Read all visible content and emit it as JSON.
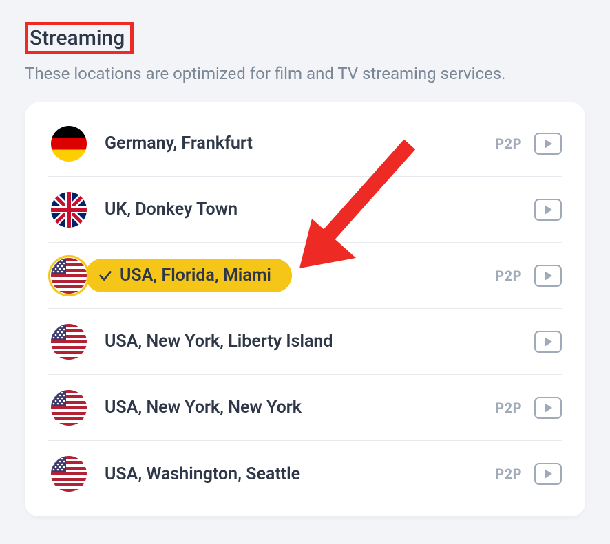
{
  "section": {
    "title": "Streaming",
    "subtitle": "These locations are optimized for film and TV streaming services."
  },
  "labels": {
    "p2p": "P2P"
  },
  "locations": [
    {
      "flag": "de",
      "name": "Germany, Frankfurt",
      "p2p": true,
      "selected": false
    },
    {
      "flag": "uk",
      "name": "UK, Donkey Town",
      "p2p": false,
      "selected": false
    },
    {
      "flag": "us",
      "name": "USA, Florida, Miami",
      "p2p": true,
      "selected": true
    },
    {
      "flag": "us",
      "name": "USA, New York, Liberty Island",
      "p2p": false,
      "selected": false
    },
    {
      "flag": "us",
      "name": "USA, New York, New York",
      "p2p": true,
      "selected": false
    },
    {
      "flag": "us",
      "name": "USA, Washington, Seattle",
      "p2p": true,
      "selected": false
    }
  ]
}
